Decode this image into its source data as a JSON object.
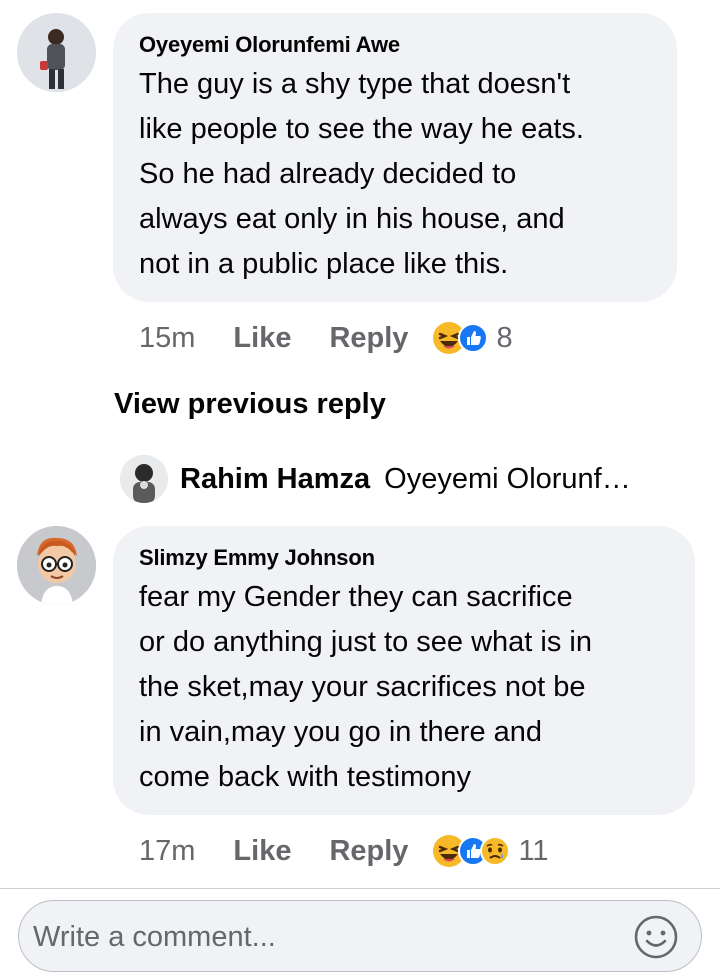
{
  "comments": [
    {
      "author": "Oyeyemi Olorunfemi Awe",
      "lines": [
        "The guy is a shy type that doesn't",
        "like people to see the way he eats.",
        "So he had already decided to",
        "always eat only in his house, and",
        "not in a public place like this."
      ],
      "time": "15m",
      "like_label": "Like",
      "reply_label": "Reply",
      "reactions": [
        "haha",
        "like"
      ],
      "reaction_count": "8"
    },
    {
      "author": "Slimzy Emmy Johnson",
      "lines": [
        "fear my Gender they can sacrifice",
        "or do anything just to see what is in",
        "the sket,may your sacrifices not be",
        "in vain,may you go in there and",
        "come back with testimony"
      ],
      "time": "17m",
      "like_label": "Like",
      "reply_label": "Reply",
      "reactions": [
        "haha",
        "like",
        "sad"
      ],
      "reaction_count": "11"
    }
  ],
  "view_previous_reply": "View previous reply",
  "reply_preview": {
    "author": "Rahim Hamza",
    "text": "Oyeyemi Olorunfemi Awe"
  },
  "composer": {
    "placeholder": "Write a comment...",
    "emoji_icon": "smiley-icon"
  },
  "colors": {
    "bubble": "#f0f2f5",
    "meta_text": "#65676b",
    "like_blue": "#1877f2",
    "haha_yellow": "#f7b928"
  }
}
